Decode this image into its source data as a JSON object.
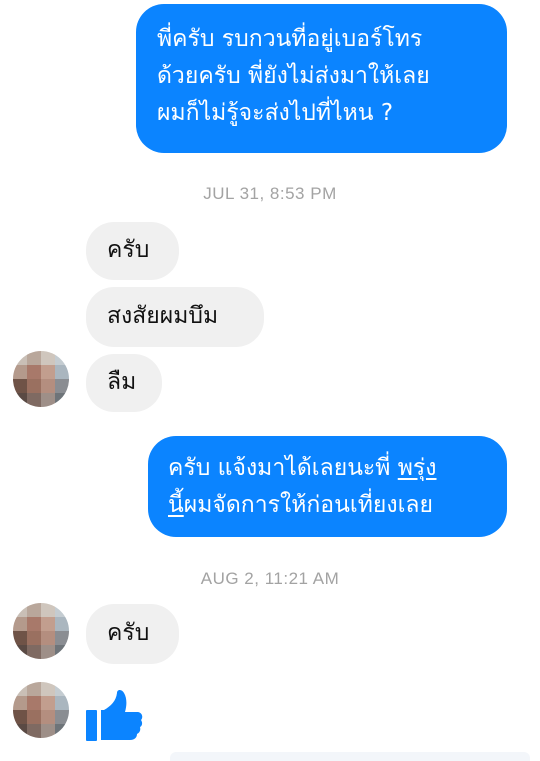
{
  "messages": {
    "m1": {
      "line1": "พี่ครับ รบกวนที่อยู่เบอร์โทร",
      "line2": "ด้วยครับ พี่ยังไม่ส่งมาให้เลย",
      "line3": "ผมก็ไม่รู้จะส่งไปที่ไหน ?"
    },
    "timestamp1": "JUL 31, 8:53 PM",
    "m2": "ครับ",
    "m3": "สงสัยผมบึม",
    "m4": "ลืม",
    "m5": {
      "line1_prefix": "ครับ แจ้งมาได้เลยนะพี่ ",
      "line1_link": "พรุ่ง",
      "line2_link": "นี้",
      "line2_rest": "ผมจัดการให้ก่อนเที่ยงเลย"
    },
    "timestamp2": "AUG 2, 11:21 AM",
    "m6": "ครับ"
  },
  "reaction": {
    "icon": "thumbs-up-icon"
  },
  "colors": {
    "outgoing_bubble": "#0b84ff",
    "incoming_bubble": "#f0f0f0",
    "timestamp": "#a3a3a3",
    "like": "#0b84ff"
  }
}
